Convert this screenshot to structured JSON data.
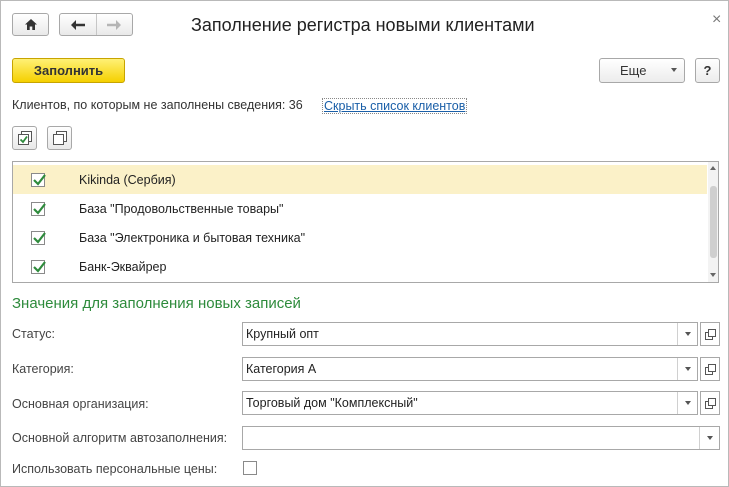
{
  "window": {
    "title": "Заполнение регистра новыми клиентами",
    "close_glyph": "×"
  },
  "toolbar": {
    "home_icon": "home-icon",
    "back_icon": "arrow-left-icon",
    "forward_icon": "arrow-right-icon",
    "fill_button": "Заполнить",
    "more_button": "Еще",
    "help_button": "?"
  },
  "info": {
    "clients_text": "Клиентов, по которым не заполнены сведения: 36",
    "hide_link": "Скрыть список клиентов"
  },
  "list_tools": {
    "check_all_icon": "check-all-icon",
    "uncheck_all_icon": "uncheck-all-icon"
  },
  "clients": [
    {
      "label": "Kikinda (Сербия)",
      "checked": true,
      "selected": true
    },
    {
      "label": "База \"Продовольственные товары\"",
      "checked": true,
      "selected": false
    },
    {
      "label": "База \"Электроника и бытовая техника\"",
      "checked": true,
      "selected": false
    },
    {
      "label": "Банк-Эквайрер",
      "checked": true,
      "selected": false
    }
  ],
  "section": {
    "title": "Значения для заполнения новых записей"
  },
  "fields": {
    "status_label": "Статус:",
    "status_value": "Крупный опт",
    "category_label": "Категория:",
    "category_value": "Категория А",
    "org_label": "Основная организация:",
    "org_value": "Торговый дом \"Комплексный\"",
    "algo_label": "Основной алгоритм автозаполнения:",
    "algo_value": "",
    "prices_label": "Использовать персональные цены:",
    "prices_checked": false
  },
  "colors": {
    "accent_yellow": "#f5d000",
    "section_green": "#2e8b3c",
    "link_blue": "#1a5fa8",
    "selected_row": "#fbf1c8"
  }
}
